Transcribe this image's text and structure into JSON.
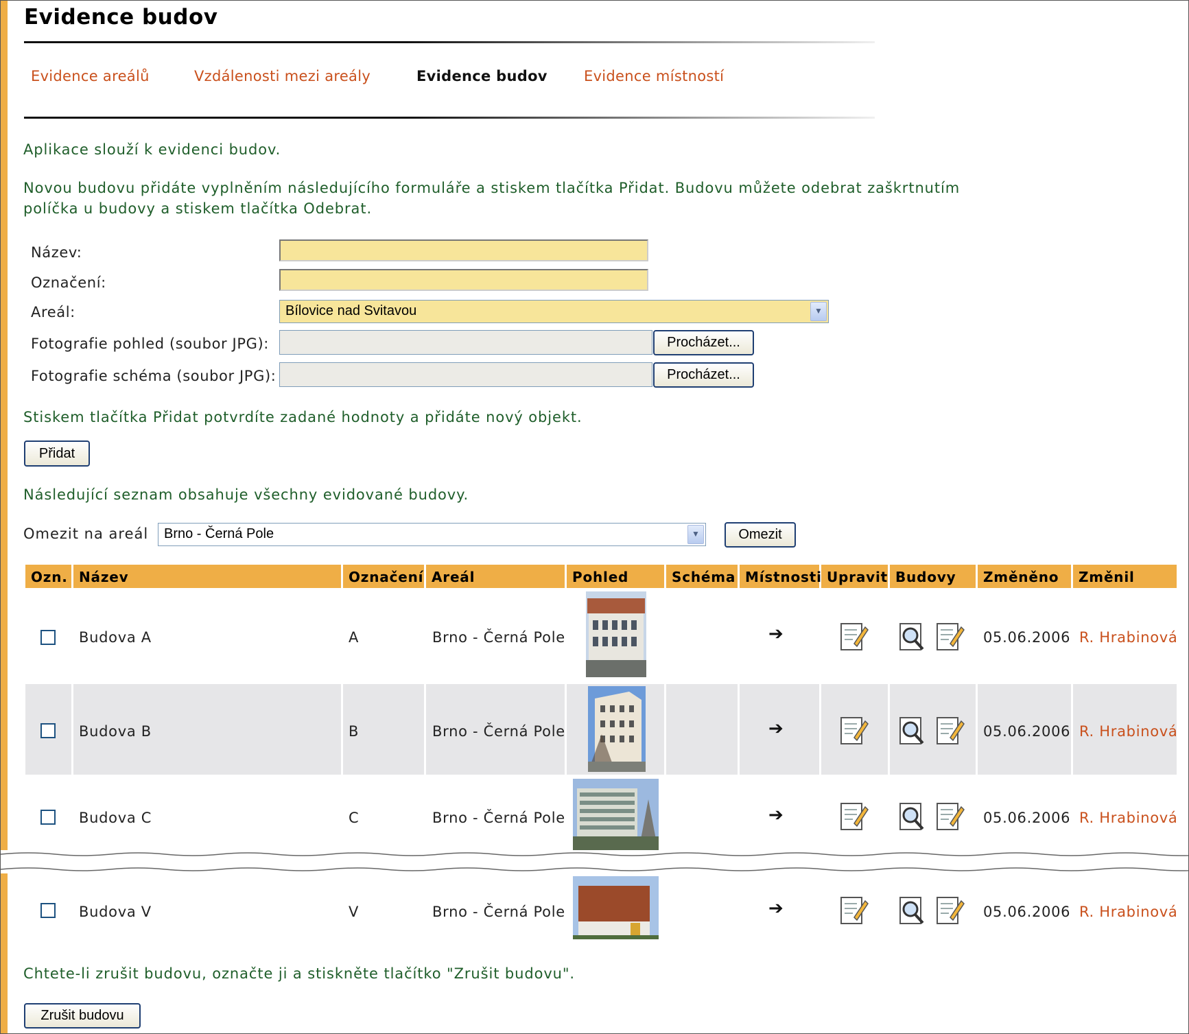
{
  "page": {
    "title": "Evidence budov"
  },
  "nav": [
    {
      "label": "Evidence areálů"
    },
    {
      "label": "Vzdálenosti mezi areály"
    },
    {
      "label": "Evidence budov"
    },
    {
      "label": "Evidence místností"
    }
  ],
  "intro": {
    "line1": "Aplikace slouží k evidenci budov.",
    "line2a": "Novou budovu přidáte vyplněním následujícího formuláře a stiskem tlačítka Přidat. Budovu můžete odebrat zaškrtnutím",
    "line2b": "políčka u budovy a stiskem tlačítka Odebrat."
  },
  "form": {
    "nazev_label": "Název:",
    "nazev_value": "",
    "oznaceni_label": "Označení:",
    "oznaceni_value": "",
    "areal_label": "Areál:",
    "areal_value": "Bílovice nad Svitavou",
    "foto_pohled_label": "Fotografie pohled (soubor JPG):",
    "foto_schema_label": "Fotografie schéma (soubor JPG):",
    "browse_label": "Procházet...",
    "hint": "Stiskem tlačítka Přidat potvrdíte zadané hodnoty a přidáte nový objekt.",
    "add_button": "Přidat"
  },
  "list": {
    "intro": "Následující seznam obsahuje všechny evidované budovy.",
    "filter_label": "Omezit na areál",
    "filter_value": "Brno - Černá Pole",
    "filter_button": "Omezit"
  },
  "table": {
    "headers": [
      "Ozn.",
      "Název",
      "Označení",
      "Areál",
      "Pohled",
      "Schéma",
      "Místnosti",
      "Upravit",
      "Budovy",
      "Změněno",
      "Změnil"
    ],
    "rows": [
      {
        "nazev": "Budova A",
        "oznaceni": "A",
        "areal": "Brno - Černá Pole",
        "zmeneno": "05.06.2006",
        "zmenil": "R. Hrabinová"
      },
      {
        "nazev": "Budova B",
        "oznaceni": "B",
        "areal": "Brno - Černá Pole",
        "zmeneno": "05.06.2006",
        "zmenil": "R. Hrabinová"
      },
      {
        "nazev": "Budova C",
        "oznaceni": "C",
        "areal": "Brno - Černá Pole",
        "zmeneno": "05.06.2006",
        "zmenil": "R. Hrabinová"
      },
      {
        "nazev": "Budova V",
        "oznaceni": "V",
        "areal": "Brno - Černá Pole",
        "zmeneno": "05.06.2006",
        "zmenil": "R. Hrabinová"
      }
    ]
  },
  "footer": {
    "hint": "Chtete-li zrušit budovu, označte ji a stiskněte tlačítko \"Zrušit budovu\".",
    "delete_button": "Zrušit budovu"
  },
  "colors": {
    "accent": "#efae46",
    "link": "#c9501c",
    "text_green": "#1f5e2a",
    "input_yellow": "#f7e59a",
    "row_alt": "#e6e6e8"
  },
  "icons": {
    "mistnosti": "arrow-right-icon",
    "upravit": "edit-note-icon",
    "budovy_view": "magnifier-note-icon",
    "budovy_edit": "edit-note-icon"
  }
}
